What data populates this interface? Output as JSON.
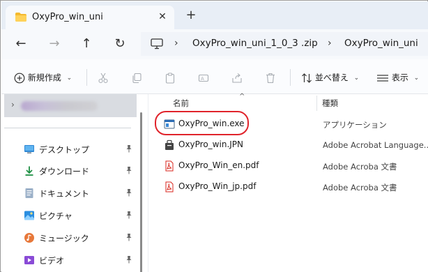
{
  "window": {
    "tab_title": "OxyPro_win_uni",
    "close_glyph": "✕",
    "new_tab_glyph": "+"
  },
  "nav": {
    "back_glyph": "←",
    "forward_glyph": "→",
    "up_glyph": "↑",
    "refresh_glyph": "↻",
    "separator": "›",
    "breadcrumbs": [
      "OxyPro_win_uni_1_0_3 .zip",
      "OxyPro_win_uni"
    ]
  },
  "toolbar": {
    "new_label": "新規作成",
    "sort_label": "並べ替え",
    "view_label": "表示",
    "chevron": "⌄",
    "more_glyph": "⌄"
  },
  "sidebar": {
    "expand_glyph": "›",
    "items": [
      {
        "label": "デスクトップ",
        "icon": "desktop-icon"
      },
      {
        "label": "ダウンロード",
        "icon": "download-icon"
      },
      {
        "label": "ドキュメント",
        "icon": "document-icon"
      },
      {
        "label": "ピクチャ",
        "icon": "pictures-icon"
      },
      {
        "label": "ミュージック",
        "icon": "music-icon"
      },
      {
        "label": "ビデオ",
        "icon": "video-icon"
      }
    ]
  },
  "file_list": {
    "sort_caret": "^",
    "columns": {
      "name": "名前",
      "type": "種類"
    },
    "rows": [
      {
        "name": "OxyPro_win.exe",
        "type": "アプリケーション",
        "icon": "exe-icon"
      },
      {
        "name": "OxyPro_win.JPN",
        "type": "Adobe Acrobat Language...",
        "icon": "jpn-file-icon"
      },
      {
        "name": "OxyPro_Win_en.pdf",
        "type": "Adobe Acroba 文書",
        "icon": "pdf-icon"
      },
      {
        "name": "OxyPro_Win_jp.pdf",
        "type": "Adobe Acroba 文書",
        "icon": "pdf-icon"
      }
    ],
    "highlight_color": "#e0232b"
  },
  "colors": {
    "accent": "#0067c0",
    "tabbar_bg": "#e8eef6",
    "pdf_red": "#d9261c"
  }
}
